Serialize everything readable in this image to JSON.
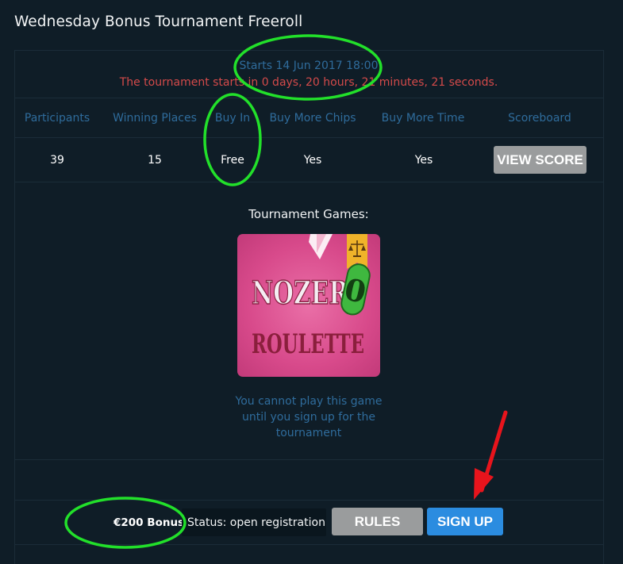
{
  "title": "Wednesday Bonus Tournament Freeroll",
  "tournament": {
    "starts": "Starts 14 Jun 2017 18:00",
    "countdown": "The tournament starts in 0 days, 20 hours, 21 minutes, 21 seconds."
  },
  "table": {
    "headers": [
      "Participants",
      "Winning Places",
      "Buy In",
      "Buy More Chips",
      "Buy More Time",
      "Scoreboard"
    ],
    "values": [
      "39",
      "15",
      "Free",
      "Yes",
      "Yes"
    ],
    "view_score_label": "VIEW SCORE"
  },
  "games": {
    "label": "Tournament Games:",
    "game_title_line1": "NOZER",
    "game_title_zero": "0",
    "game_title_line2": "ROULETTE",
    "message": "You cannot play this game until you sign up for the tournament"
  },
  "footer": {
    "bonus": "€200 Bonus",
    "status": "Status: open registration",
    "rules_label": "RULES",
    "signup_label": "SIGN UP"
  },
  "annotation_colors": {
    "highlight": "#22e02a",
    "arrow": "#e8141c"
  },
  "icons": [
    "scale-badge-icon"
  ]
}
